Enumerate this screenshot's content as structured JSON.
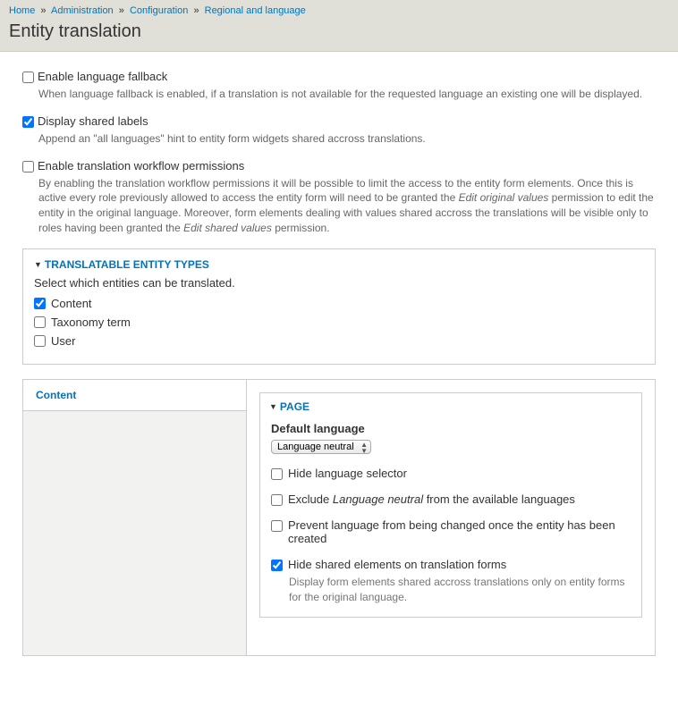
{
  "breadcrumb": {
    "home": "Home",
    "admin": "Administration",
    "config": "Configuration",
    "regional": "Regional and language"
  },
  "page_title": "Entity translation",
  "fallback": {
    "label": "Enable language fallback",
    "desc": "When language fallback is enabled, if a translation is not available for the requested language an existing one will be displayed."
  },
  "shared_labels": {
    "label": "Display shared labels",
    "desc": "Append an \"all languages\" hint to entity form widgets shared accross translations."
  },
  "workflow": {
    "label": "Enable translation workflow permissions",
    "desc_a": "By enabling the translation workflow permissions it will be possible to limit the access to the entity form elements. Once this is active every role previously allowed to access the entity form will need to be granted the ",
    "desc_em1": "Edit original values",
    "desc_b": " permission to edit the entity in the original language. Moreover, form elements dealing with values shared accross the translations will be visible only to roles having been granted the ",
    "desc_em2": "Edit shared values",
    "desc_c": " permission."
  },
  "translatable": {
    "legend": "Translatable entity types",
    "desc": "Select which entities can be translated.",
    "content": "Content",
    "taxonomy": "Taxonomy term",
    "user": "User"
  },
  "tab": {
    "content": "Content"
  },
  "page_section": {
    "legend": "Page",
    "default_lang_label": "Default language",
    "default_lang_value": "Language neutral",
    "hide_selector": "Hide language selector",
    "exclude_a": "Exclude ",
    "exclude_em": "Language neutral",
    "exclude_b": " from the available languages",
    "prevent": "Prevent language from being changed once the entity has been created",
    "hide_shared": "Hide shared elements on translation forms",
    "hide_shared_desc": "Display form elements shared accross translations only on entity forms for the original language."
  }
}
